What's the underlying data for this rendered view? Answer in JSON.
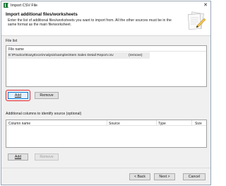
{
  "window": {
    "title": "Import CSV File",
    "close_glyph": "✕"
  },
  "header": {
    "title": "Import additional files/worksheets",
    "description": "Enter the list of additional files/worksheets you want to import from.  All the other sources must be in the same format as the main file/worksheet."
  },
  "file_list": {
    "label": "File list",
    "columns": [
      "File name"
    ],
    "rows": [
      {
        "file_name": "E:\\Practice\\EasyExcelAnalysis\\samples\\Item Sales Detail Report.csv",
        "remove_label": "(remove)"
      }
    ],
    "add_label": "Add",
    "remove_label": "Remove"
  },
  "additional_columns": {
    "label": "Additional columns to identify source (optional)",
    "columns": [
      "Column name",
      "Source",
      "Type",
      "Size"
    ],
    "add_label": "Add",
    "remove_label": "Remove"
  },
  "footer": {
    "back_label": "< Back",
    "next_label": "Next >",
    "cancel_label": "Cancel"
  },
  "colors": {
    "highlight": "#e0212a",
    "focus_border": "#0078d7",
    "row_bg": "#ebebeb"
  }
}
